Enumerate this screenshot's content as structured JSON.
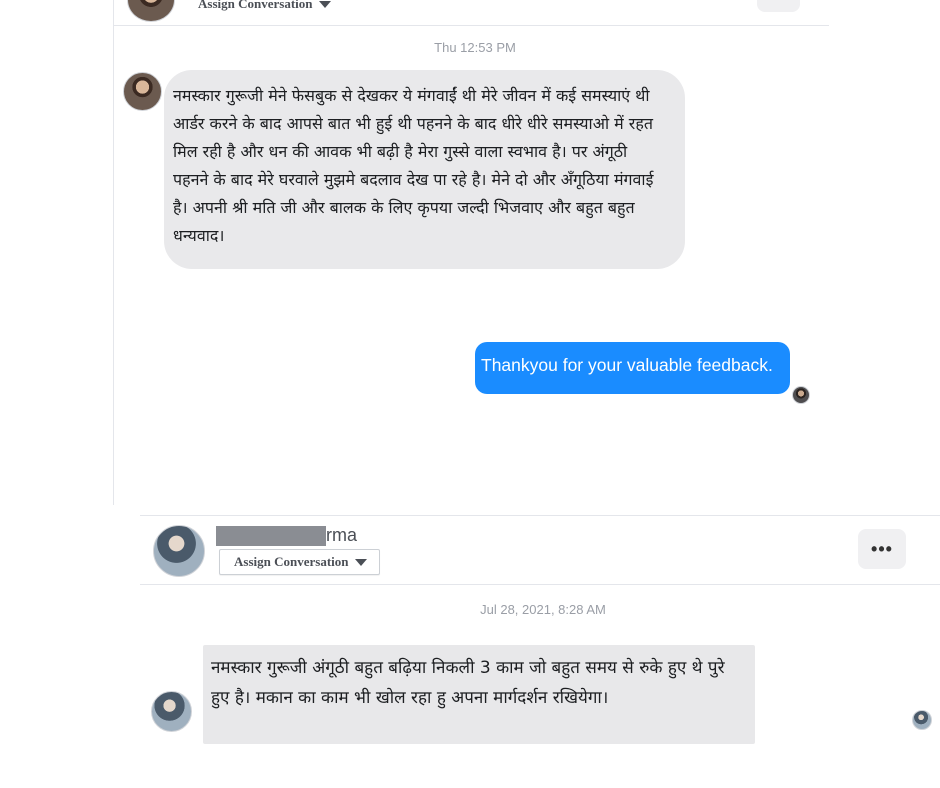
{
  "conversation1": {
    "assign_label": "Assign Conversation",
    "timestamp": "Thu 12:53 PM",
    "incoming_message": "नमस्कार गुरूजी मेने फेसबुक से देखकर ये मंगवाईं थी मेरे जीवन में कई समस्याएं थी आर्डर करने के बाद आपसे बात भी हुई थी पहनने के बाद धीरे धीरे समस्याओ में रहत मिल रही है और धन की आवक भी बढ़ी है मेरा गुस्से वाला स्वभाव है। पर अंगूठी पहनने के बाद मेरे घरवाले मुझमे बदलाव देख पा रहे है। मेने दो और अँगूठिया मंगवाई है। अपनी श्री मति जी और बालक के लिए कृपया जल्दी भिजवाए और बहुत बहुत धन्यवाद।",
    "outgoing_message": "Thankyou for your valuable feedback."
  },
  "conversation2": {
    "contact_name_suffix": "rma",
    "assign_label": "Assign Conversation",
    "more_label": "•••",
    "timestamp": "Jul 28, 2021, 8:28 AM",
    "incoming_message": "नमस्कार गुरूजी अंगूठी बहुत बढ़िया निकली 3 काम जो बहुत समय से रुके हुए थे पुरे हुए है। मकान का काम भी खोल रहा हु अपना मार्गदर्शन रखियेगा।"
  },
  "colors": {
    "outgoing_bubble": "#1a8cff",
    "incoming_bubble": "#e9e9eb",
    "timestamp_text": "#9a9ea6"
  }
}
